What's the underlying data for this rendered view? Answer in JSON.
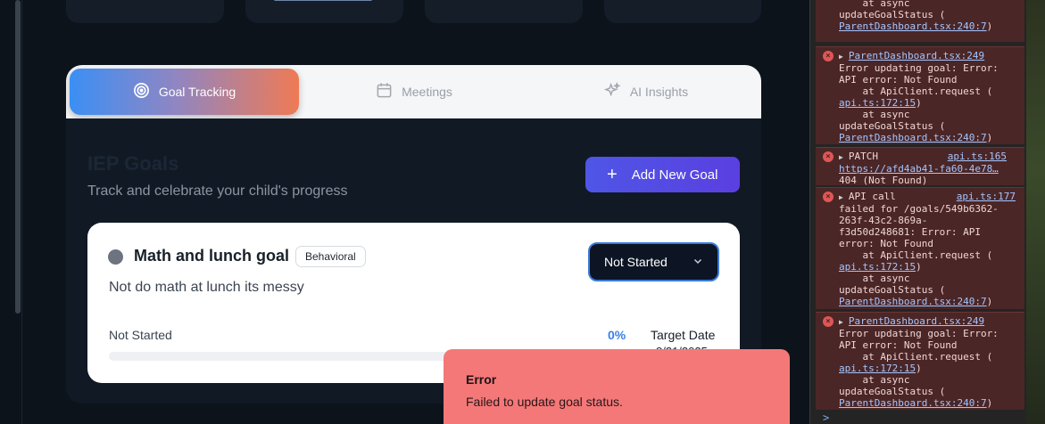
{
  "tabs": [
    {
      "label": "Goal Tracking",
      "icon": "target-icon",
      "active": true
    },
    {
      "label": "Meetings",
      "icon": "calendar-icon",
      "active": false
    },
    {
      "label": "AI Insights",
      "icon": "sparkles-icon",
      "active": false
    }
  ],
  "goals_section": {
    "title": "IEP Goals",
    "subtitle": "Track and celebrate your child's progress",
    "add_button": "Add New Goal"
  },
  "goal": {
    "title": "Math and lunch goal",
    "category": "Behavioral",
    "description": "Not do math at lunch its messy",
    "status_select": "Not Started",
    "progress_label": "Not Started",
    "progress_percent_text": "0%",
    "progress_fraction": 0,
    "target_label": "Target Date",
    "target_value": "8/31/2025"
  },
  "toast": {
    "title": "Error",
    "message": "Failed to update goal status."
  },
  "console": {
    "entries": [
      {
        "lines": [
          "    at async",
          "updateGoalStatus ("
        ],
        "link": "ParentDashboard.tsx:240:7",
        "tail": ")"
      },
      {
        "source": "ParentDashboard.tsx:249",
        "lines": [
          "Error updating goal: Error:",
          "API error: Not Found",
          "    at ApiClient.request ("
        ],
        "link1": "api.ts:172:15",
        "mid": [
          "    at async",
          "updateGoalStatus ("
        ],
        "link2": "ParentDashboard.tsx:240:7"
      },
      {
        "method": "PATCH",
        "source": "api.ts:165",
        "url": "https://afd4ab41-fa60-4e78…",
        "status": "404 (Not Found)"
      },
      {
        "prefix": "API call",
        "source": "api.ts:177",
        "lines": [
          "failed for /goals/549b6362-",
          "263f-43c2-869a-",
          "f3d50d248681: Error: API",
          "error: Not Found",
          "    at ApiClient.request ("
        ],
        "link1": "api.ts:172:15",
        "mid": [
          "    at async",
          "updateGoalStatus ("
        ],
        "link2": "ParentDashboard.tsx:240:7"
      },
      {
        "source": "ParentDashboard.tsx:249",
        "lines": [
          "Error updating goal: Error:",
          "API error: Not Found",
          "    at ApiClient.request ("
        ],
        "link1": "api.ts:172:15",
        "mid": [
          "    at async",
          "updateGoalStatus ("
        ],
        "link2": "ParentDashboard.tsx:240:7"
      }
    ],
    "prompt": ">"
  }
}
